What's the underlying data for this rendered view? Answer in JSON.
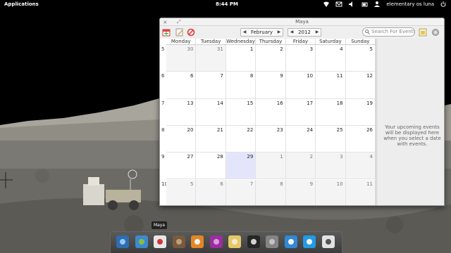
{
  "top_panel": {
    "applications": "Applications",
    "clock": "8:44 PM",
    "user": "elementary os luna",
    "icons": [
      "network-icon",
      "mail-icon",
      "volume-icon",
      "battery-icon",
      "user-icon",
      "power-icon"
    ]
  },
  "window": {
    "title": "Maya",
    "toolbar": {
      "month": "February",
      "year": "2012",
      "search_placeholder": "Search For Events",
      "icons": [
        "add-calendar-icon",
        "edit-icon",
        "delete-icon",
        "today-icon",
        "settings-icon"
      ]
    },
    "calendar": {
      "day_headers": [
        "Monday",
        "Tuesday",
        "Wednesday",
        "Thursday",
        "Friday",
        "Saturday",
        "Sunday"
      ],
      "weeks": [
        {
          "num": "5",
          "days": [
            "30",
            "31",
            "1",
            "2",
            "3",
            "4",
            "5"
          ],
          "outside": [
            true,
            true,
            false,
            false,
            false,
            false,
            false
          ]
        },
        {
          "num": "6",
          "days": [
            "6",
            "7",
            "8",
            "9",
            "10",
            "11",
            "12"
          ],
          "outside": [
            false,
            false,
            false,
            false,
            false,
            false,
            false
          ]
        },
        {
          "num": "7",
          "days": [
            "13",
            "14",
            "15",
            "16",
            "17",
            "18",
            "19"
          ],
          "outside": [
            false,
            false,
            false,
            false,
            false,
            false,
            false
          ]
        },
        {
          "num": "8",
          "days": [
            "20",
            "21",
            "22",
            "23",
            "24",
            "25",
            "26"
          ],
          "outside": [
            false,
            false,
            false,
            false,
            false,
            false,
            false
          ]
        },
        {
          "num": "9",
          "days": [
            "27",
            "28",
            "29",
            "1",
            "2",
            "3",
            "4"
          ],
          "outside": [
            false,
            false,
            false,
            true,
            true,
            true,
            true
          ]
        },
        {
          "num": "10",
          "days": [
            "5",
            "6",
            "7",
            "8",
            "9",
            "10",
            "11"
          ],
          "outside": [
            true,
            true,
            true,
            true,
            true,
            true,
            true
          ]
        }
      ],
      "today": "29"
    },
    "sidebar_message": "Your upcoming events will be displayed here when you select a date with events."
  },
  "dock": {
    "tooltip": "Maya",
    "items": [
      "anchor-icon",
      "browser-icon",
      "calendar-icon",
      "contacts-icon",
      "music-icon",
      "notebook-icon",
      "mail-icon",
      "terminal-icon",
      "switchboard-icon",
      "download-icon",
      "bird-icon",
      "text-editor-icon"
    ]
  }
}
